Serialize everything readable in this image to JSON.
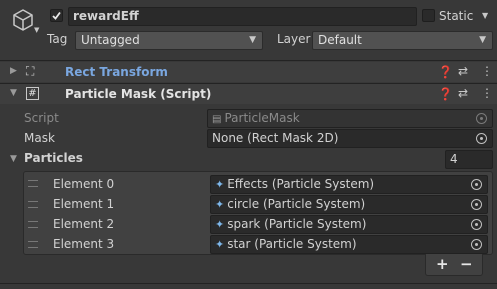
{
  "gameobject": {
    "active": true,
    "name": "rewardEff",
    "static_label": "Static",
    "tag_label": "Tag",
    "tag_value": "Untagged",
    "layer_label": "Layer",
    "layer_value": "Default"
  },
  "components": {
    "rect_transform": {
      "title": "Rect Transform"
    },
    "particle_mask": {
      "title": "Particle Mask (Script)",
      "script_label": "Script",
      "script_value": "ParticleMask",
      "mask_label": "Mask",
      "mask_value": "None (Rect Mask 2D)",
      "particles_label": "Particles",
      "particles_count": "4",
      "elements": [
        {
          "label": "Element 0",
          "value": "Effects (Particle System)"
        },
        {
          "label": "Element 1",
          "value": "circle (Particle System)"
        },
        {
          "label": "Element 2",
          "value": "spark (Particle System)"
        },
        {
          "label": "Element 3",
          "value": "star (Particle System)"
        }
      ]
    }
  },
  "buttons": {
    "add": "+",
    "remove": "−"
  },
  "icons": {
    "gameobject": "cube-icon",
    "rect_transform": "rect-transform-icon",
    "script": "script-hash-icon",
    "help": "help-icon",
    "presets": "presets-icon",
    "menu": "kebab-menu-icon",
    "particle_system": "particle-system-icon",
    "object_picker": "object-picker-icon"
  },
  "colors": {
    "background": "#383838",
    "rect_transform_title": "#7aa7e0",
    "field": "#2a2a2a"
  }
}
